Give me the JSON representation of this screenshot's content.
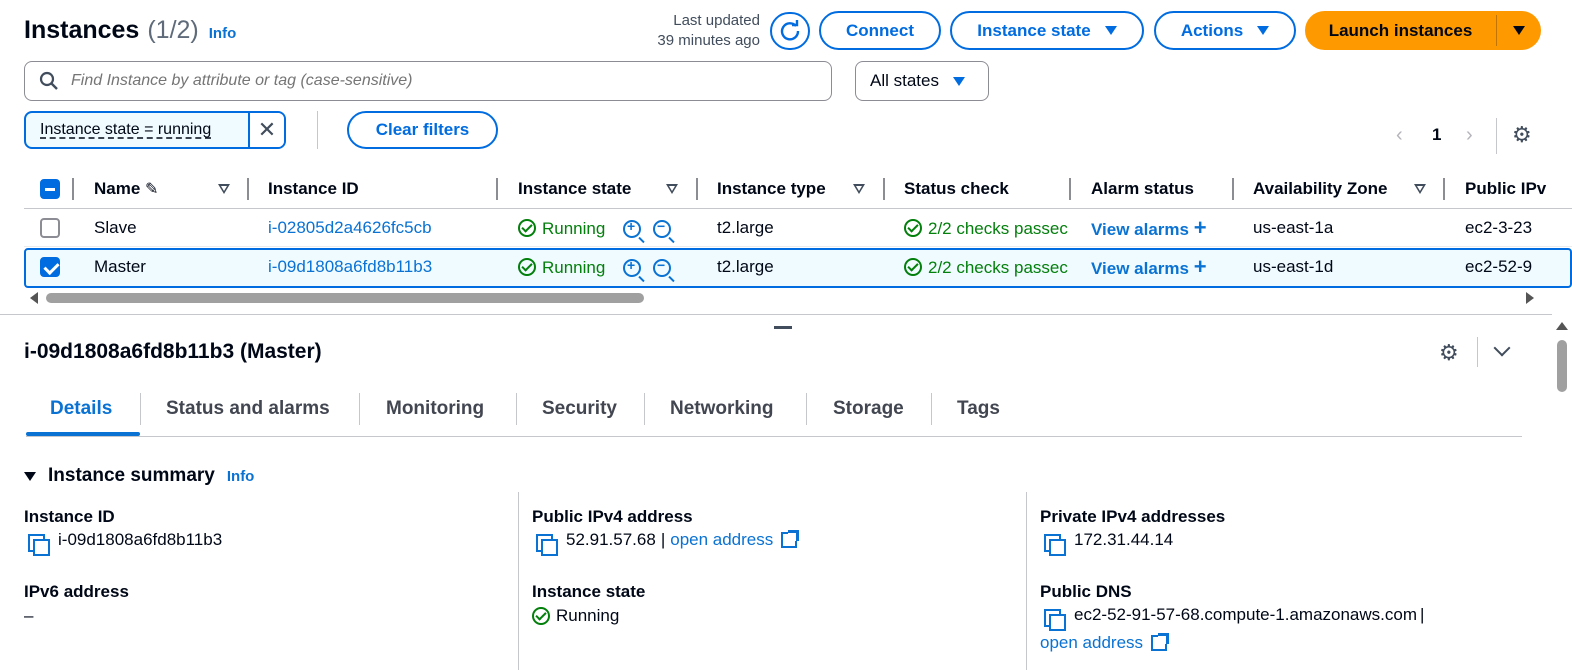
{
  "header": {
    "title": "Instances",
    "count": "(1/2)",
    "info": "Info",
    "last_updated_line1": "Last updated",
    "last_updated_line2": "39 minutes ago",
    "connect": "Connect",
    "instance_state": "Instance state",
    "actions": "Actions",
    "launch": "Launch instances"
  },
  "search": {
    "placeholder": "Find Instance by attribute or tag (case-sensitive)",
    "states_select": "All states"
  },
  "filters": {
    "token": "Instance state = running",
    "clear": "Clear filters",
    "page": "1"
  },
  "table": {
    "columns": [
      "Name",
      "Instance ID",
      "Instance state",
      "Instance type",
      "Status check",
      "Alarm status",
      "Availability Zone",
      "Public IPv"
    ],
    "rows": [
      {
        "name": "Slave",
        "id": "i-02805d2a4626fc5cb",
        "state": "Running",
        "type": "t2.large",
        "status": "2/2 checks passec",
        "alarm": "View alarms",
        "az": "us-east-1a",
        "ip": "ec2-3-23"
      },
      {
        "name": "Master",
        "id": "i-09d1808a6fd8b11b3",
        "state": "Running",
        "type": "t2.large",
        "status": "2/2 checks passec",
        "alarm": "View alarms",
        "az": "us-east-1d",
        "ip": "ec2-52-9"
      }
    ]
  },
  "details": {
    "title": "i-09d1808a6fd8b11b3 (Master)",
    "tabs": [
      "Details",
      "Status and alarms",
      "Monitoring",
      "Security",
      "Networking",
      "Storage",
      "Tags"
    ],
    "summary_title": "Instance summary",
    "summary_info": "Info",
    "instance_id_label": "Instance ID",
    "instance_id": "i-09d1808a6fd8b11b3",
    "ipv6_label": "IPv6 address",
    "ipv6": "–",
    "public_ip_label": "Public IPv4 address",
    "public_ip": "52.91.57.68",
    "sep": "|",
    "open_address": "open address",
    "instance_state_label": "Instance state",
    "instance_state": "Running",
    "private_ip_label": "Private IPv4 addresses",
    "private_ip": "172.31.44.14",
    "public_dns_label": "Public DNS",
    "public_dns": "ec2-52-91-57-68.compute-1.amazonaws.com",
    "open_address_2": "open address"
  },
  "colors": {
    "accent": "#006ce0",
    "launch": "#ff9900",
    "running": "#037f0c"
  }
}
